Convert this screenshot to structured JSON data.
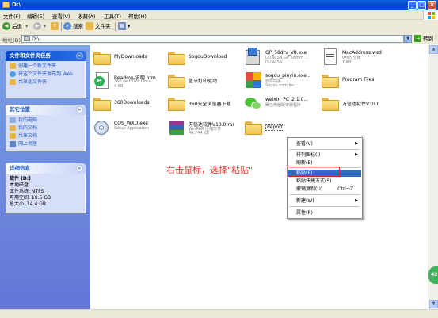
{
  "window": {
    "title": "D:\\"
  },
  "menubar": {
    "items": [
      "文件(F)",
      "编辑(E)",
      "查看(V)",
      "收藏(A)",
      "工具(T)",
      "帮助(H)"
    ]
  },
  "toolbar": {
    "back": "后退",
    "search": "搜索",
    "folders": "文件夹"
  },
  "address": {
    "label": "地址(D)",
    "value": "D:\\",
    "go": "转到"
  },
  "tasks": {
    "file_tasks": {
      "title": "文件和文件夹任务",
      "links": [
        "创建一个新文件夹",
        "将这个文件夹发布到 Web",
        "共享此文件夹"
      ]
    },
    "other_places": {
      "title": "其它位置",
      "links": [
        "我的电脑",
        "我的文档",
        "共享文档",
        "网上邻居"
      ]
    },
    "details": {
      "title": "详细信息",
      "name": "软件 (D:)",
      "type": "本地磁盘",
      "fs": "文件系统: NTFS",
      "free": "可用空间: 10.5 GB",
      "total": "总大小: 14.4 GB"
    }
  },
  "files": [
    {
      "name": "MyDownloads",
      "icon": "folder"
    },
    {
      "name": "SogouDownload",
      "icon": "folder"
    },
    {
      "l1": "GP_58drv_V8.exe",
      "l2": "DUNCSN GP 58mm ...",
      "l3": "DUNCSN",
      "icon": "installer-icon"
    },
    {
      "l1": "MacAddress.wsd",
      "l2": "WSD 文件",
      "l3": "1 KB",
      "icon": "document-icon"
    },
    {
      "l1": "Readme-说明.htm",
      "l2": "360 se HTML Docu...",
      "l3": "4 KB",
      "icon": "html-icon"
    },
    {
      "name": "蓝牙打印驱动",
      "icon": "folder"
    },
    {
      "l1": "sogou_pinyin.exe...",
      "l2": "软件助手",
      "l3": "Sogou.com Inc.",
      "icon": "sogou-icon"
    },
    {
      "name": "Program Files",
      "icon": "folder"
    },
    {
      "name": "360Downloads",
      "icon": "folder"
    },
    {
      "name": "360安全浏览器下载",
      "icon": "folder"
    },
    {
      "l1": "weixin_PC_2.1.0...",
      "l2": "微信电脑版安装程序",
      "l3": "",
      "icon": "wechat-icon"
    },
    {
      "name": "万信达软件V10.0",
      "icon": "folder"
    },
    {
      "l1": "COS_WXD.exe",
      "l2": "Setup Application",
      "l3": "",
      "icon": "setup-icon"
    },
    {
      "l1": "万信达软件V10.0.rar",
      "l2": "WinRAR 压缩文件",
      "l3": "40,744 KB",
      "icon": "rar-icon"
    },
    {
      "name": "Report",
      "icon": "folder"
    }
  ],
  "context_menu": {
    "items": [
      {
        "label": "查看(V)",
        "submenu": true
      },
      {
        "label": "排列图标(I)",
        "submenu": true
      },
      {
        "label": "刷新(E)"
      },
      {
        "label": "粘贴(P)",
        "highlighted": true
      },
      {
        "label": "粘贴快捷方式(S)"
      },
      {
        "label": "撤销复制(U)",
        "shortcut": "Ctrl+Z"
      },
      {
        "label": "新建(W)",
        "submenu": true
      },
      {
        "label": "属性(R)"
      }
    ]
  },
  "annotation": "右击鼠标，选择\"粘贴\"",
  "badge": "42"
}
